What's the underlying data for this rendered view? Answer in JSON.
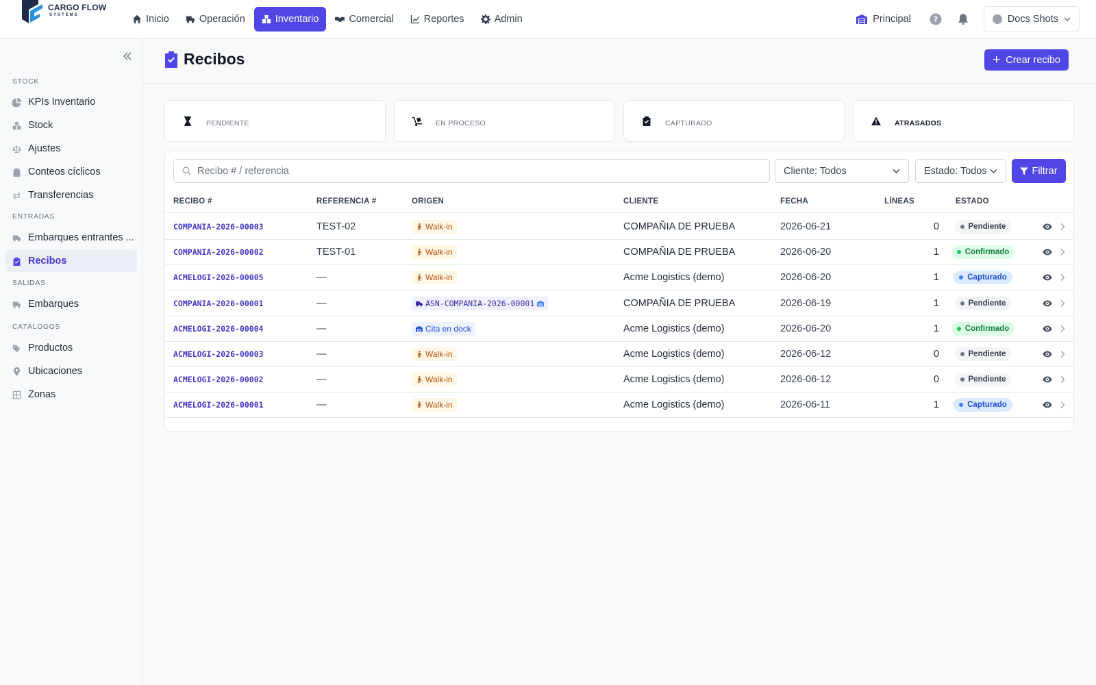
{
  "brand": {
    "title": "CARGO FLOW",
    "subtitle": "SYSTEMS"
  },
  "nav": [
    {
      "label": "Inicio",
      "icon": "home-icon"
    },
    {
      "label": "Operación",
      "icon": "truck-icon"
    },
    {
      "label": "Inventario",
      "icon": "boxes-icon",
      "active": true
    },
    {
      "label": "Comercial",
      "icon": "handshake-icon"
    },
    {
      "label": "Reportes",
      "icon": "chart-line-icon"
    },
    {
      "label": "Admin",
      "icon": "gear-icon"
    }
  ],
  "top_right": {
    "branch": "Principal",
    "user": "Docs Shots"
  },
  "sidebar": {
    "sections": [
      {
        "title": "STOCK",
        "items": [
          {
            "label": "KPIs Inventario",
            "icon": "pie-chart-icon"
          },
          {
            "label": "Stock",
            "icon": "boxes-icon"
          },
          {
            "label": "Ajustes",
            "icon": "scale-icon"
          },
          {
            "label": "Conteos cíclicos",
            "icon": "clipboard-icon"
          },
          {
            "label": "Transferencias",
            "icon": "arrows-exchange-icon"
          }
        ]
      },
      {
        "title": "ENTRADAS",
        "items": [
          {
            "label": "Embarques entrantes ...",
            "icon": "truck-loading-icon"
          },
          {
            "label": "Recibos",
            "icon": "clipboard-check-icon",
            "active": true
          }
        ]
      },
      {
        "title": "SALIDAS",
        "items": [
          {
            "label": "Embarques",
            "icon": "truck-icon"
          }
        ]
      },
      {
        "title": "CATÁLOGOS",
        "items": [
          {
            "label": "Productos",
            "icon": "tags-icon"
          },
          {
            "label": "Ubicaciones",
            "icon": "map-pin-icon"
          },
          {
            "label": "Zonas",
            "icon": "grid-icon"
          }
        ]
      }
    ]
  },
  "page": {
    "title": "Recibos",
    "create_label": "Crear recibo"
  },
  "stats": [
    {
      "label": "PENDIENTE",
      "icon": "hourglass-icon"
    },
    {
      "label": "EN PROCESO",
      "icon": "dolly-icon"
    },
    {
      "label": "CAPTURADO",
      "icon": "clipboard-check-icon"
    },
    {
      "label": "ATRASADOS",
      "icon": "warning-icon"
    }
  ],
  "filters": {
    "search_placeholder": "Recibo # / referencia",
    "cliente": "Cliente: Todos",
    "estado": "Estado: Todos",
    "filter_label": "Filtrar"
  },
  "table": {
    "columns": [
      "RECIBO #",
      "REFERENCIA #",
      "ORIGEN",
      "CLIENTE",
      "FECHA",
      "LÍNEAS",
      "ESTADO"
    ],
    "rows": [
      {
        "recibo": "COMPANIA-2026-00003",
        "ref": "TEST-02",
        "origin": "Walk-in",
        "origin_type": "walkin",
        "cliente": "COMPAÑIA DE PRUEBA",
        "fecha": "2026-06-21",
        "lineas": "0",
        "estado": "Pendiente",
        "estado_type": "pend"
      },
      {
        "recibo": "COMPANIA-2026-00002",
        "ref": "TEST-01",
        "origin": "Walk-in",
        "origin_type": "walkin",
        "cliente": "COMPAÑIA DE PRUEBA",
        "fecha": "2026-06-20",
        "lineas": "1",
        "estado": "Confirmado",
        "estado_type": "conf"
      },
      {
        "recibo": "ACMELOGI-2026-00005",
        "ref": "—",
        "origin": "Walk-in",
        "origin_type": "walkin",
        "cliente": "Acme Logistics (demo)",
        "fecha": "2026-06-20",
        "lineas": "1",
        "estado": "Capturado",
        "estado_type": "capt"
      },
      {
        "recibo": "COMPANIA-2026-00001",
        "ref": "—",
        "origin": "ASN-COMPANIA-2026-00001",
        "origin_type": "asn",
        "cliente": "COMPAÑIA DE PRUEBA",
        "fecha": "2026-06-19",
        "lineas": "1",
        "estado": "Pendiente",
        "estado_type": "pend"
      },
      {
        "recibo": "ACMELOGI-2026-00004",
        "ref": "—",
        "origin": "Cita en dock",
        "origin_type": "cita",
        "cliente": "Acme Logistics (demo)",
        "fecha": "2026-06-20",
        "lineas": "1",
        "estado": "Confirmado",
        "estado_type": "conf"
      },
      {
        "recibo": "ACMELOGI-2026-00003",
        "ref": "—",
        "origin": "Walk-in",
        "origin_type": "walkin",
        "cliente": "Acme Logistics (demo)",
        "fecha": "2026-06-12",
        "lineas": "0",
        "estado": "Pendiente",
        "estado_type": "pend"
      },
      {
        "recibo": "ACMELOGI-2026-00002",
        "ref": "—",
        "origin": "Walk-in",
        "origin_type": "walkin",
        "cliente": "Acme Logistics (demo)",
        "fecha": "2026-06-12",
        "lineas": "0",
        "estado": "Pendiente",
        "estado_type": "pend"
      },
      {
        "recibo": "ACMELOGI-2026-00001",
        "ref": "—",
        "origin": "Walk-in",
        "origin_type": "walkin",
        "cliente": "Acme Logistics (demo)",
        "fecha": "2026-06-11",
        "lineas": "1",
        "estado": "Capturado",
        "estado_type": "capt"
      }
    ]
  },
  "colors": {
    "accent": "#4f46e5",
    "link": "#4338ca",
    "walkin": "#b45309",
    "confirmed": "#15803d",
    "captured": "#1d4ed8"
  }
}
